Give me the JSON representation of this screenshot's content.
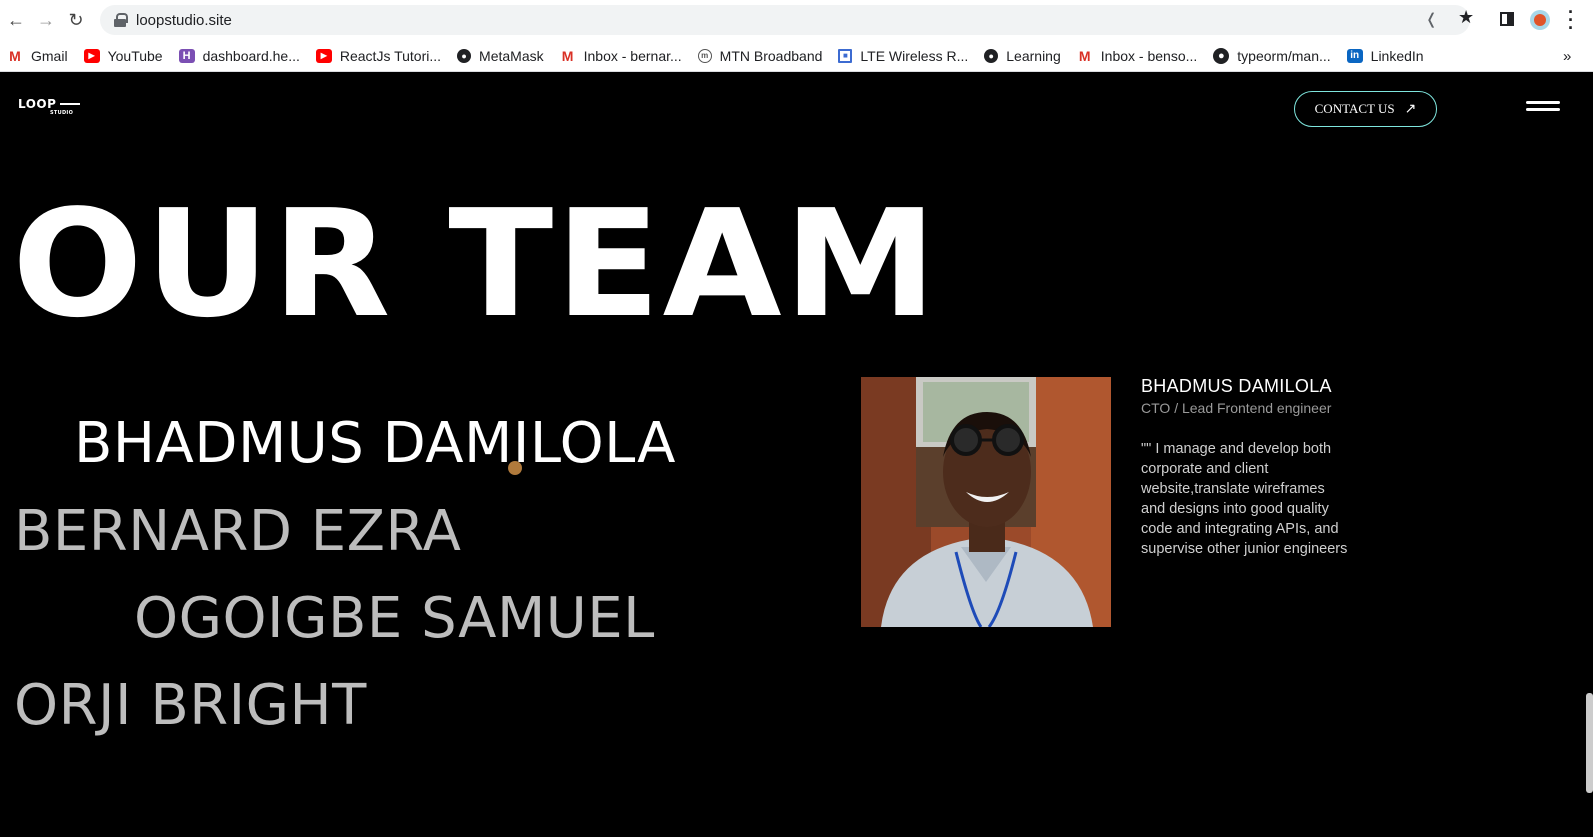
{
  "browser": {
    "url": "loopstudio.site",
    "bookmarks": [
      {
        "label": "Gmail",
        "icon": "gmail-icon"
      },
      {
        "label": "YouTube",
        "icon": "youtube-icon"
      },
      {
        "label": "dashboard.he...",
        "icon": "dashboard-icon"
      },
      {
        "label": "ReactJs Tutori...",
        "icon": "youtube-icon"
      },
      {
        "label": "MetaMask",
        "icon": "globe-icon"
      },
      {
        "label": "Inbox - bernar...",
        "icon": "gmail-icon"
      },
      {
        "label": "MTN Broadband",
        "icon": "mtn-icon"
      },
      {
        "label": "LTE Wireless R...",
        "icon": "lte-icon"
      },
      {
        "label": "Learning",
        "icon": "globe-icon"
      },
      {
        "label": "Inbox - benso...",
        "icon": "gmail-icon"
      },
      {
        "label": "typeorm/man...",
        "icon": "github-icon"
      },
      {
        "label": "LinkedIn",
        "icon": "linkedin-icon"
      }
    ],
    "more": "»"
  },
  "site": {
    "logo_main": "LOOP",
    "logo_sub": "STUDIO",
    "contact_label": "CONTACT US",
    "contact_arrow": "↗",
    "title": "OUR TEAM",
    "members": [
      {
        "name": "BHADMUS DAMILOLA",
        "active": true
      },
      {
        "name": "BERNARD EZRA",
        "active": false
      },
      {
        "name": "OGOIGBE SAMUEL",
        "active": false
      },
      {
        "name": "ORJI BRIGHT",
        "active": false
      }
    ],
    "bio": {
      "name": "BHADMUS DAMILOLA",
      "role": "CTO / Lead Frontend engineer",
      "text": "\"\" I manage and develop both corporate and client website,translate wireframes and designs into good quality code and integrating APIs, and supervise other junior engineers"
    }
  },
  "colors": {
    "background": "#000000",
    "accent": "#7fe6de",
    "cursor": "#b07a3c"
  }
}
